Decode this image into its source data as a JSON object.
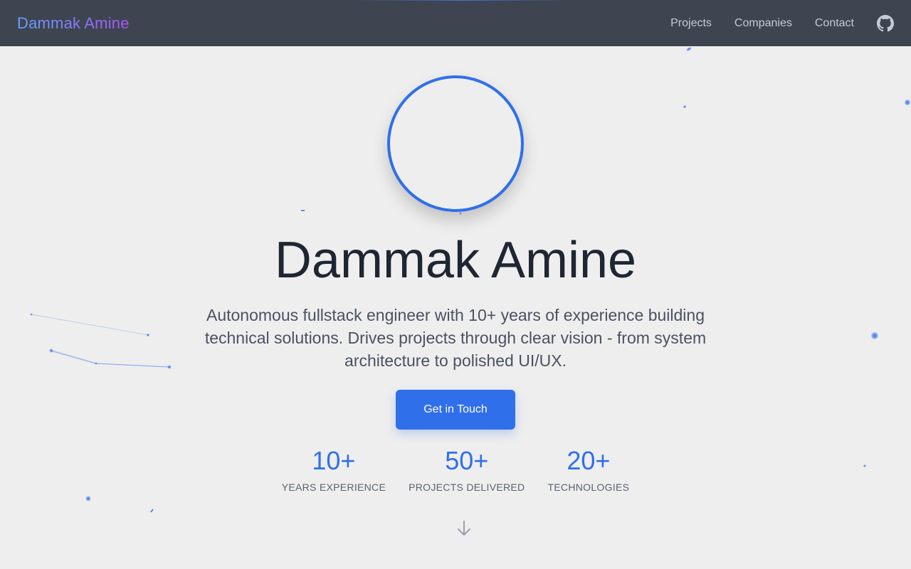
{
  "nav": {
    "brand": "Dammak Amine",
    "links": [
      "Projects",
      "Companies",
      "Contact"
    ],
    "github_icon": "github-icon"
  },
  "hero": {
    "name": "Dammak Amine",
    "description": "Autonomous fullstack engineer with 10+ years of experience building technical solutions. Drives projects through clear vision - from system architecture to polished UI/UX.",
    "cta_label": "Get in Touch",
    "stats": [
      {
        "value": "10+",
        "label": "YEARS EXPERIENCE"
      },
      {
        "value": "50+",
        "label": "PROJECTS DELIVERED"
      },
      {
        "value": "20+",
        "label": "TECHNOLOGIES"
      }
    ],
    "scroll_icon": "arrow-down-icon"
  },
  "colors": {
    "accent": "#2f6fea",
    "navbar_bg": "#3f4451",
    "page_bg": "#eeeeee",
    "heading": "#1f2633",
    "brand_gradient_start": "#60a5fa",
    "brand_gradient_end": "#a855f7"
  }
}
